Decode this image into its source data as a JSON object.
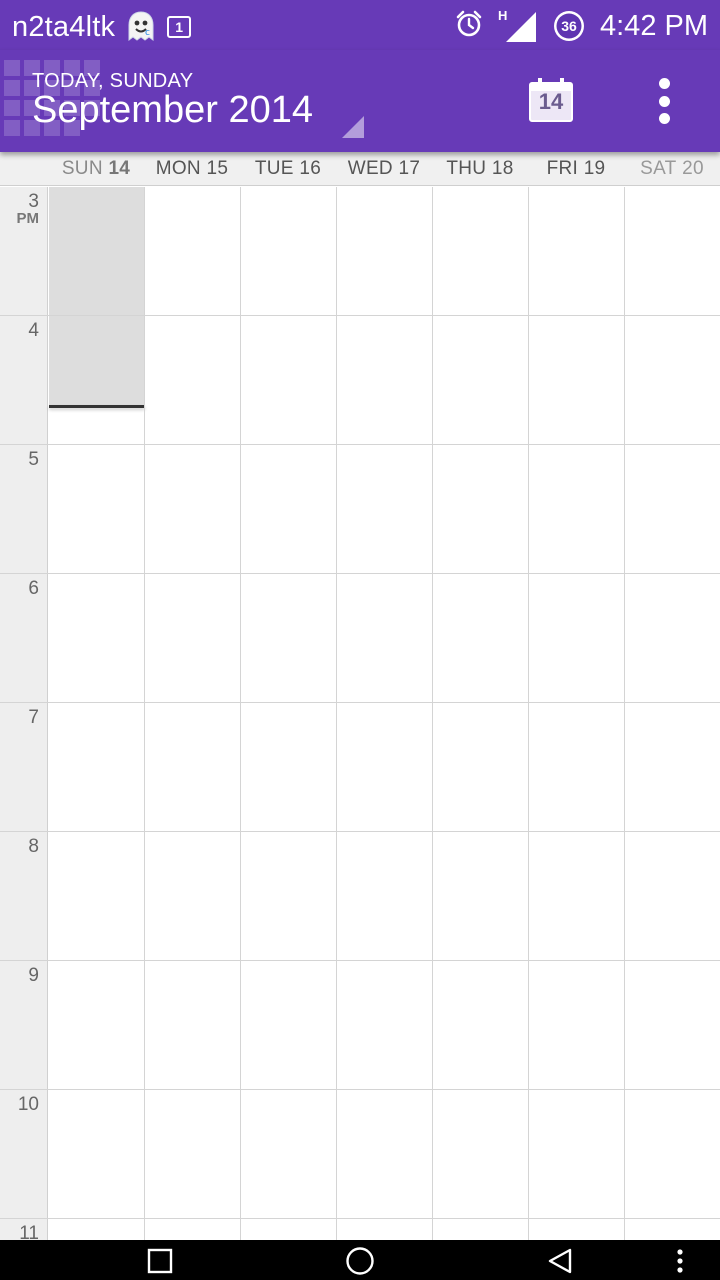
{
  "status_bar": {
    "carrier": "n2ta4ltk",
    "notification_count": "1",
    "network_type": "H",
    "battery_level": "36",
    "time": "4:42 PM"
  },
  "header": {
    "subtitle": "TODAY, SUNDAY",
    "title": "September 2014",
    "today_button_day": "14"
  },
  "days": [
    {
      "name": "SUN",
      "num": "14"
    },
    {
      "name": "MON",
      "num": "15"
    },
    {
      "name": "TUE",
      "num": "16"
    },
    {
      "name": "WED",
      "num": "17"
    },
    {
      "name": "THU",
      "num": "18"
    },
    {
      "name": "FRI",
      "num": "19"
    },
    {
      "name": "SAT",
      "num": "20"
    }
  ],
  "hours": [
    {
      "label": "3",
      "ampm": "PM"
    },
    {
      "label": "4",
      "ampm": ""
    },
    {
      "label": "5",
      "ampm": ""
    },
    {
      "label": "6",
      "ampm": ""
    },
    {
      "label": "7",
      "ampm": ""
    },
    {
      "label": "8",
      "ampm": ""
    },
    {
      "label": "9",
      "ampm": ""
    },
    {
      "label": "10",
      "ampm": ""
    },
    {
      "label": "11",
      "ampm": ""
    }
  ],
  "colors": {
    "primary": "#673ab7",
    "today_shade": "#dddddd"
  },
  "icons": {
    "app_notification": "ghost-icon",
    "alarm": "alarm-icon",
    "signal": "signal-icon",
    "battery": "battery-icon",
    "today": "calendar-today-icon",
    "overflow": "more-vert-icon",
    "nav_recents": "square-icon",
    "nav_home": "circle-icon",
    "nav_back": "triangle-back-icon",
    "nav_menu": "more-vert-icon"
  }
}
